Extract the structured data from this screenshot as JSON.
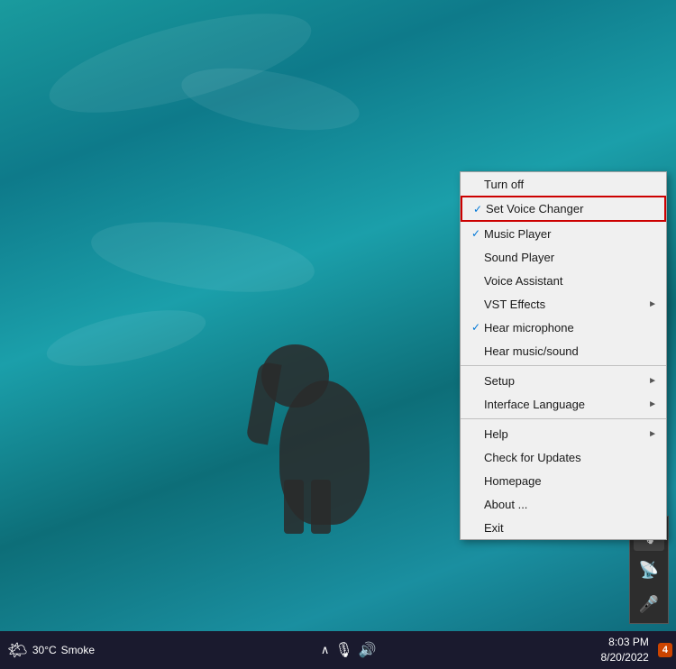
{
  "desktop": {
    "bg_desc": "underwater elephant scene teal ocean"
  },
  "context_menu": {
    "items": [
      {
        "id": "turn-off",
        "label": "Turn off",
        "check": "",
        "submenu": false,
        "separator_after": false,
        "highlighted": false
      },
      {
        "id": "set-voice-changer",
        "label": "Set Voice Changer",
        "check": "✓",
        "submenu": false,
        "separator_after": false,
        "highlighted": true
      },
      {
        "id": "music-player",
        "label": "Music Player",
        "check": "✓",
        "submenu": false,
        "separator_after": false,
        "highlighted": false
      },
      {
        "id": "sound-player",
        "label": "Sound Player",
        "check": "",
        "submenu": false,
        "separator_after": false,
        "highlighted": false
      },
      {
        "id": "voice-assistant",
        "label": "Voice Assistant",
        "check": "",
        "submenu": false,
        "separator_after": false,
        "highlighted": false
      },
      {
        "id": "vst-effects",
        "label": "VST Effects",
        "check": "",
        "submenu": true,
        "separator_after": false,
        "highlighted": false
      },
      {
        "id": "hear-microphone",
        "label": "Hear microphone",
        "check": "✓",
        "submenu": false,
        "separator_after": false,
        "highlighted": false
      },
      {
        "id": "hear-music-sound",
        "label": "Hear music/sound",
        "check": "",
        "submenu": false,
        "separator_after": true,
        "highlighted": false
      },
      {
        "id": "setup",
        "label": "Setup",
        "check": "",
        "submenu": true,
        "separator_after": false,
        "highlighted": false
      },
      {
        "id": "interface-lang",
        "label": "Interface Language",
        "check": "",
        "submenu": true,
        "separator_after": true,
        "highlighted": false
      },
      {
        "id": "help",
        "label": "Help",
        "check": "",
        "submenu": true,
        "separator_after": false,
        "highlighted": false
      },
      {
        "id": "check-updates",
        "label": "Check for Updates",
        "check": "",
        "submenu": false,
        "separator_after": false,
        "highlighted": false
      },
      {
        "id": "homepage",
        "label": "Homepage",
        "check": "",
        "submenu": false,
        "separator_after": false,
        "highlighted": false
      },
      {
        "id": "about",
        "label": "About ...",
        "check": "",
        "submenu": false,
        "separator_after": false,
        "highlighted": false
      },
      {
        "id": "exit",
        "label": "Exit",
        "check": "",
        "submenu": false,
        "separator_after": false,
        "highlighted": false
      }
    ]
  },
  "side_tray": {
    "icons": [
      {
        "id": "tray-icon-1",
        "symbol": "🎙️"
      },
      {
        "id": "tray-icon-2",
        "symbol": "📡"
      },
      {
        "id": "tray-icon-3",
        "symbol": "🎤"
      }
    ]
  },
  "taskbar": {
    "weather_icon": "🌤",
    "temperature": "30°C",
    "weather_condition": "Smoke",
    "time": "8:03 PM",
    "date": "8/20/2022",
    "notification_count": "4",
    "icons": {
      "chevron": "^",
      "microphone": "🎙",
      "volume": "🔊"
    }
  }
}
